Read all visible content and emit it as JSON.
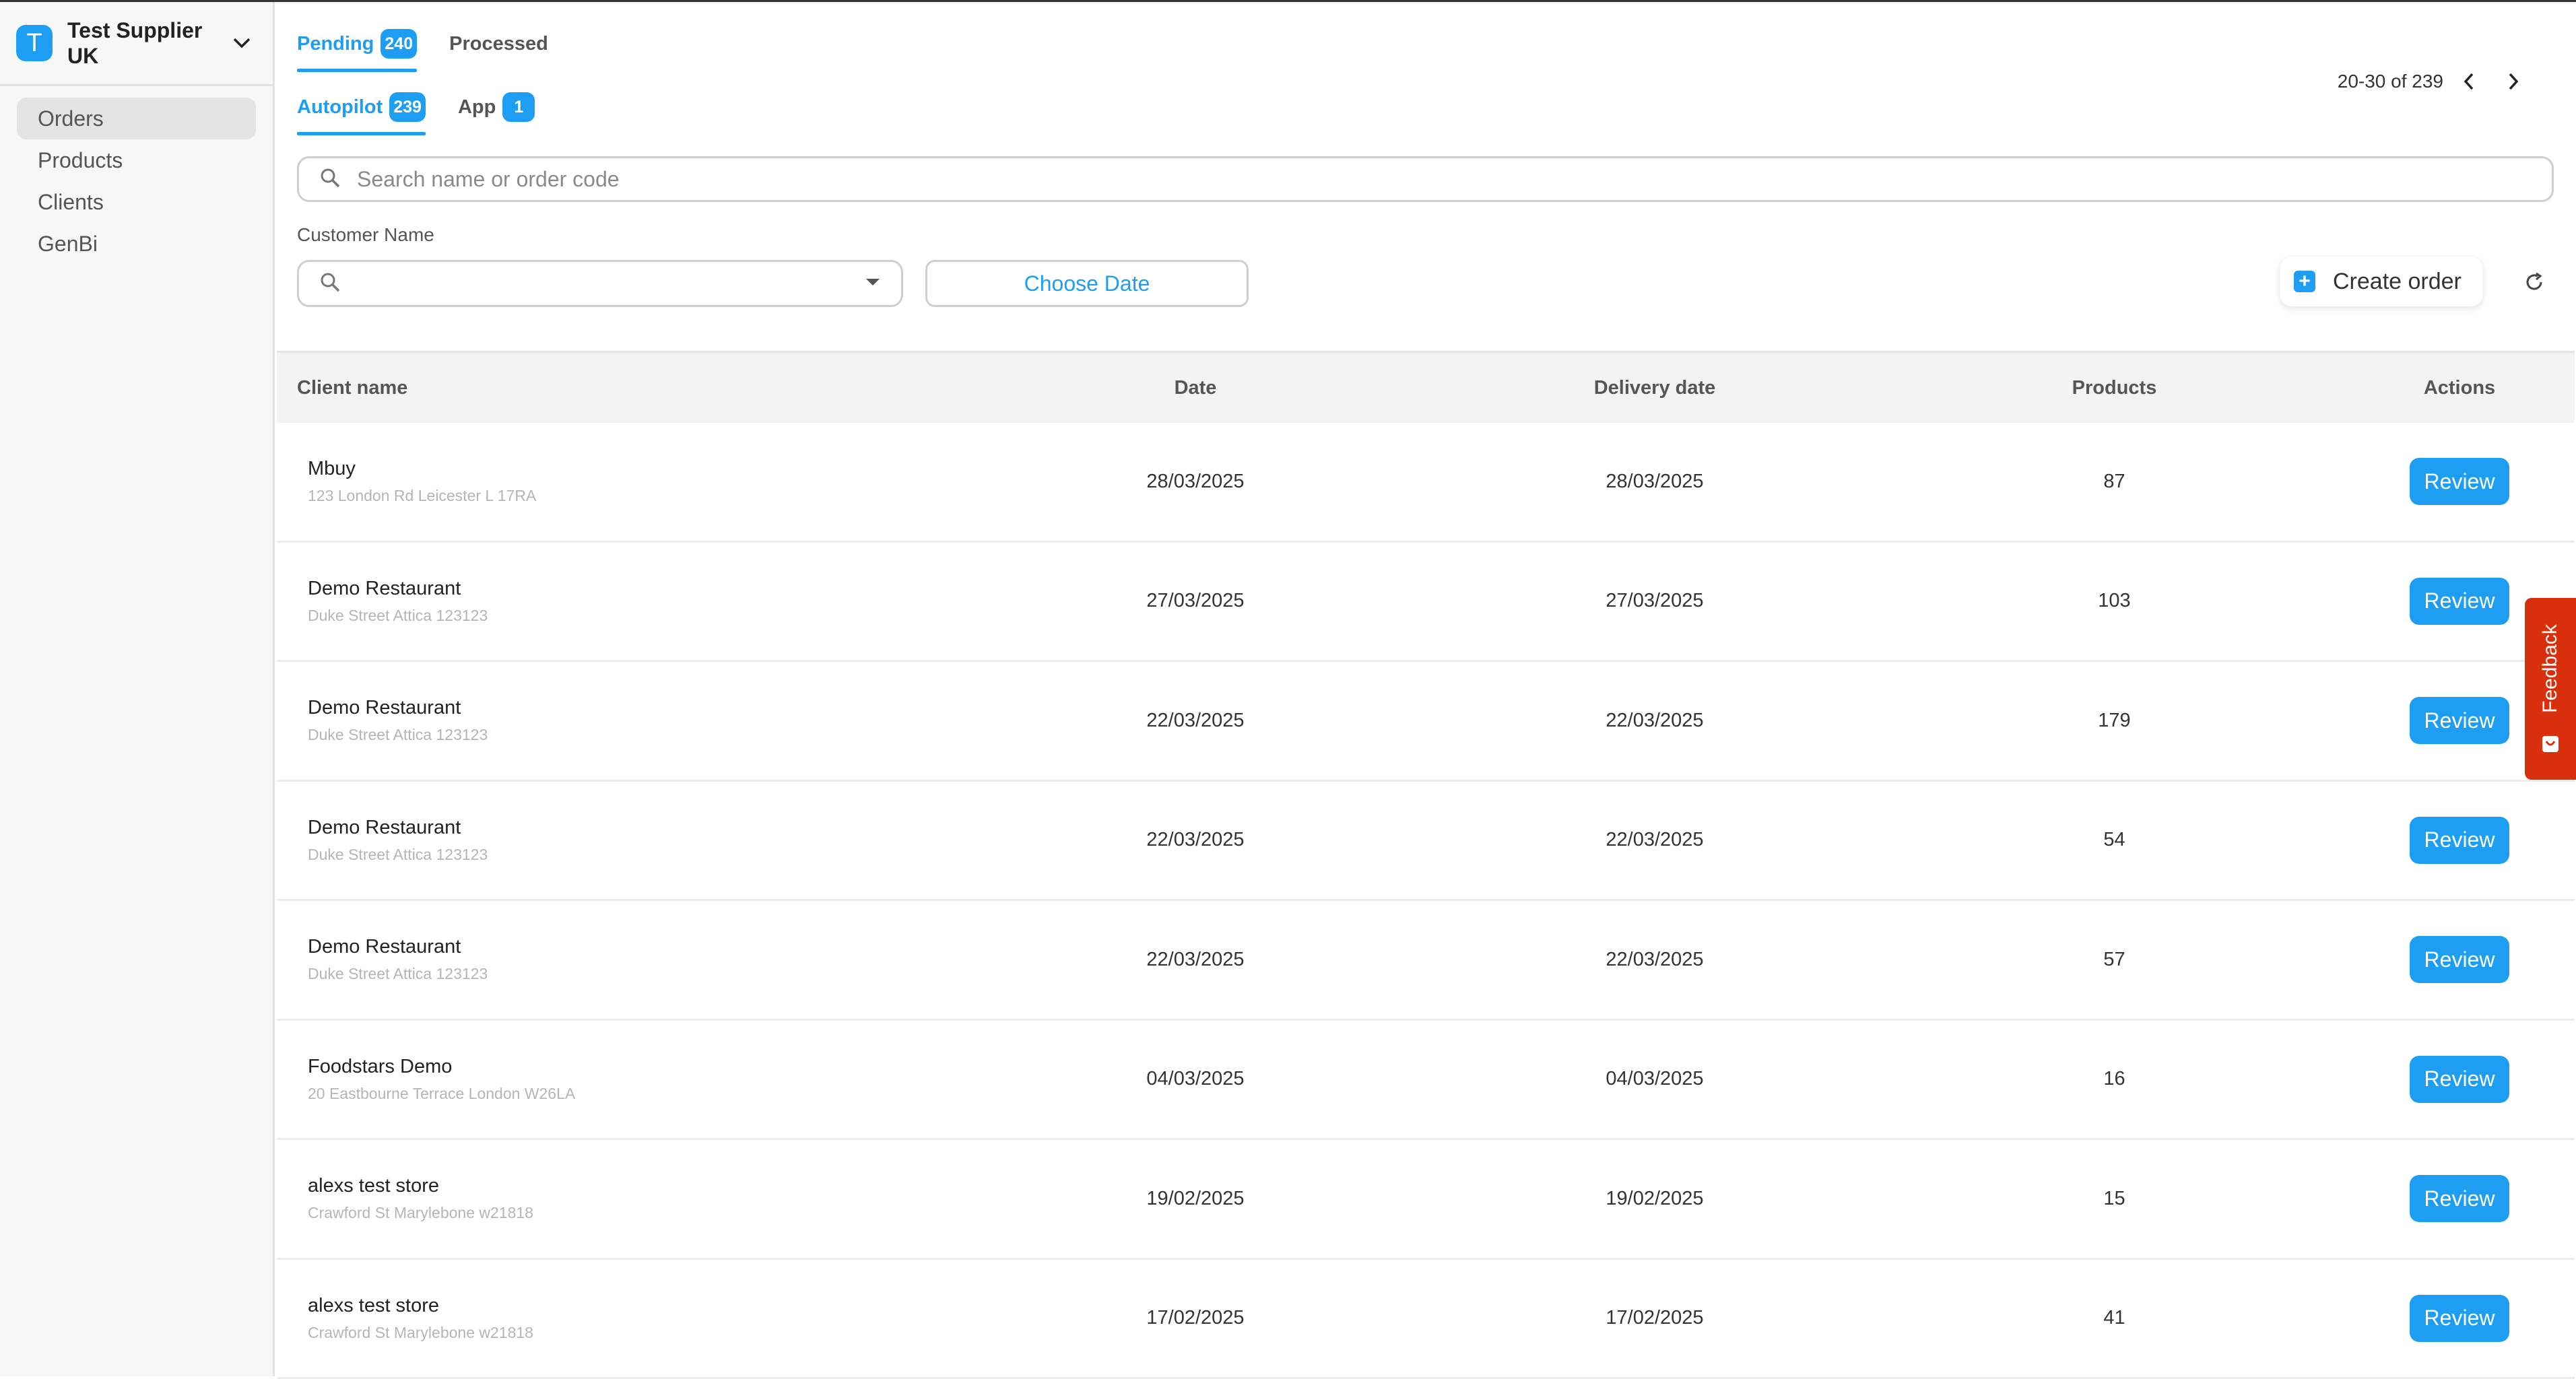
{
  "org": {
    "avatar_letter": "T",
    "name": "Test Supplier UK"
  },
  "sidebar": {
    "items": [
      {
        "label": "Orders",
        "active": true
      },
      {
        "label": "Products"
      },
      {
        "label": "Clients"
      },
      {
        "label": "GenBi"
      }
    ]
  },
  "status_tabs": [
    {
      "label": "Pending",
      "count": "240",
      "active": true
    },
    {
      "label": "Processed"
    }
  ],
  "source_tabs": [
    {
      "label": "Autopilot",
      "count": "239",
      "active": true
    },
    {
      "label": "App",
      "count": "1"
    }
  ],
  "pagination": {
    "range": "20-30 of 239"
  },
  "search": {
    "placeholder": "Search name or order code"
  },
  "filters": {
    "customer_label": "Customer Name",
    "customer_value": "",
    "date_button": "Choose Date"
  },
  "actions": {
    "create_order": "Create order"
  },
  "table": {
    "headers": {
      "client": "Client name",
      "date": "Date",
      "delivery": "Delivery date",
      "products": "Products",
      "actions": "Actions"
    },
    "review_label": "Review",
    "rows": [
      {
        "name": "Mbuy",
        "address": "123 London Rd Leicester L 17RA",
        "date": "28/03/2025",
        "delivery": "28/03/2025",
        "products": "87"
      },
      {
        "name": "Demo Restaurant",
        "address": "Duke Street Attica 123123",
        "date": "27/03/2025",
        "delivery": "27/03/2025",
        "products": "103"
      },
      {
        "name": "Demo Restaurant",
        "address": "Duke Street Attica 123123",
        "date": "22/03/2025",
        "delivery": "22/03/2025",
        "products": "179"
      },
      {
        "name": "Demo Restaurant",
        "address": "Duke Street Attica 123123",
        "date": "22/03/2025",
        "delivery": "22/03/2025",
        "products": "54"
      },
      {
        "name": "Demo Restaurant",
        "address": "Duke Street Attica 123123",
        "date": "22/03/2025",
        "delivery": "22/03/2025",
        "products": "57"
      },
      {
        "name": "Foodstars Demo",
        "address": "20 Eastbourne Terrace London W26LA",
        "date": "04/03/2025",
        "delivery": "04/03/2025",
        "products": "16"
      },
      {
        "name": "alexs test store",
        "address": "Crawford St Marylebone w21818",
        "date": "19/02/2025",
        "delivery": "19/02/2025",
        "products": "15"
      },
      {
        "name": "alexs test store",
        "address": "Crawford St Marylebone w21818",
        "date": "17/02/2025",
        "delivery": "17/02/2025",
        "products": "41"
      }
    ]
  },
  "feedback": {
    "label": "Feedback"
  },
  "colors": {
    "accent": "#1d9ef2",
    "feedback": "#d8300c"
  }
}
